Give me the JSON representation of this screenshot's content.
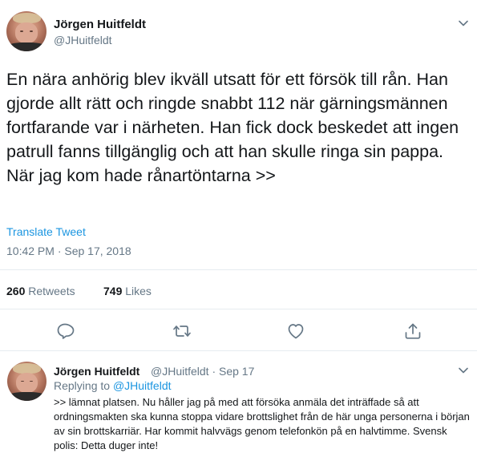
{
  "main_tweet": {
    "author_name": "Jörgen Huitfeldt",
    "author_handle": "@JHuitfeldt",
    "text": "En nära anhörig blev ikväll utsatt för ett försök till rån. Han gjorde allt rätt och ringde snabbt 112 när gärningsmännen fortfarande var i närheten. Han fick dock beskedet att ingen patrull fanns tillgänglig och att han skulle ringa sin pappa. När jag kom hade rånartöntarna >>",
    "translate_label": "Translate Tweet",
    "timestamp": "10:42 PM · Sep 17, 2018",
    "retweets_count": "260",
    "retweets_label": "Retweets",
    "likes_count": "749",
    "likes_label": "Likes"
  },
  "reply": {
    "author_name": "Jörgen Huitfeldt",
    "author_handle": "@JHuitfeldt · Sep 17",
    "replying_prefix": "Replying to",
    "replying_to": "@JHuitfeldt",
    "text": ">> lämnat platsen. Nu håller jag på med att försöka anmäla det inträffade så att ordningsmakten ska kunna stoppa vidare brottslighet från de här unga personerna i början av sin brottskarriär. Har kommit halvvägs genom telefonkön på en halvtimme. Svensk polis: Detta duger inte!"
  },
  "icons": {
    "reply": "reply-icon",
    "retweet": "retweet-icon",
    "like": "heart-icon",
    "share": "share-icon",
    "menu": "chevron-down-icon"
  },
  "colors": {
    "link": "#1b95e0",
    "secondary_text": "#657786",
    "primary_text": "#14171a",
    "divider": "#e6ecf0"
  }
}
